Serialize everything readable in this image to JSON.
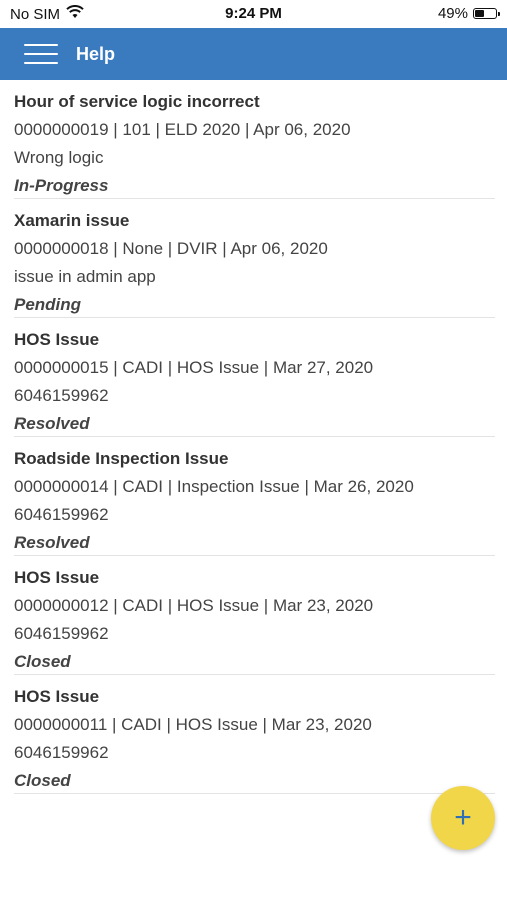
{
  "status_bar": {
    "carrier": "No SIM",
    "time": "9:24 PM",
    "battery": "49%",
    "battery_level": 0.49
  },
  "app_bar": {
    "title": "Help",
    "menu_icon": "hamburger-menu-icon",
    "color": "#3a7bbf"
  },
  "tickets": [
    {
      "title": "Hour of service logic incorrect",
      "meta": "0000000019  | 101  | ELD 2020 |  Apr 06, 2020",
      "description": "Wrong logic",
      "status": "In-Progress"
    },
    {
      "title": "Xamarin issue",
      "meta": "0000000018  | None  | DVIR |  Apr 06, 2020",
      "description": "issue in admin app",
      "status": "Pending"
    },
    {
      "title": "HOS Issue",
      "meta": "0000000015  | CADI  | HOS Issue |  Mar 27, 2020",
      "description": "6046159962",
      "status": "Resolved"
    },
    {
      "title": "Roadside Inspection Issue",
      "meta": "0000000014  | CADI  | Inspection Issue |  Mar 26, 2020",
      "description": "6046159962",
      "status": "Resolved"
    },
    {
      "title": "HOS Issue",
      "meta": "0000000012  | CADI  | HOS Issue |  Mar 23, 2020",
      "description": "6046159962",
      "status": "Closed"
    },
    {
      "title": "HOS Issue",
      "meta": "0000000011  | CADI  | HOS Issue |  Mar 23, 2020",
      "description": "6046159962",
      "status": "Closed"
    }
  ],
  "fab": {
    "icon": "plus-icon",
    "symbol": "+",
    "color": "#f1d64a"
  }
}
